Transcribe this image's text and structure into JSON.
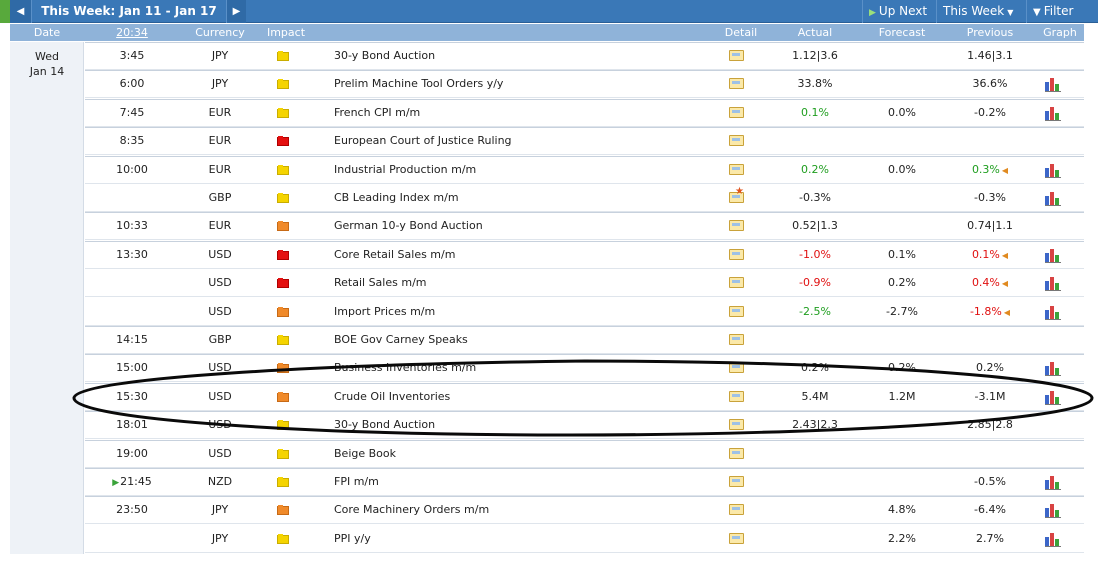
{
  "topbar": {
    "prev_arrow": "◀",
    "title": "This Week: Jan 11 - Jan 17",
    "next_arrow": "▶",
    "up_next": "Up Next",
    "this_week": "This Week",
    "filter": "Filter"
  },
  "header": {
    "date": "Date",
    "time": "20:34",
    "currency": "Currency",
    "impact": "Impact",
    "detail": "Detail",
    "actual": "Actual",
    "forecast": "Forecast",
    "previous": "Previous",
    "graph": "Graph"
  },
  "date_group": {
    "day": "Wed",
    "date": "Jan 14"
  },
  "rows": [
    {
      "time": "3:45",
      "currency": "JPY",
      "impact": "low",
      "event": "30-y Bond Auction",
      "actual": "1.12|3.6",
      "forecast": "",
      "previous": "1.46|3.1",
      "graph": false
    },
    {
      "time": "6:00",
      "currency": "JPY",
      "impact": "low",
      "event": "Prelim Machine Tool Orders y/y",
      "actual": "33.8%",
      "forecast": "",
      "previous": "36.6%",
      "graph": true
    },
    {
      "time": "7:45",
      "currency": "EUR",
      "impact": "low",
      "event": "French CPI m/m",
      "actual": "0.1%",
      "actual_color": "green",
      "forecast": "0.0%",
      "previous": "-0.2%",
      "graph": true
    },
    {
      "time": "8:35",
      "currency": "EUR",
      "impact": "high",
      "event": "European Court of Justice Ruling",
      "actual": "",
      "forecast": "",
      "previous": "",
      "graph": false
    },
    {
      "time": "10:00",
      "currency": "EUR",
      "impact": "low",
      "event": "Industrial Production m/m",
      "actual": "0.2%",
      "actual_color": "green",
      "forecast": "0.0%",
      "previous": "0.3%",
      "previous_color": "green",
      "revised": true,
      "graph": true
    },
    {
      "time": "",
      "currency": "GBP",
      "impact": "low",
      "event": "CB Leading Index m/m",
      "actual": "-0.3%",
      "forecast": "",
      "previous": "-0.3%",
      "graph": true,
      "star": true
    },
    {
      "time": "10:33",
      "currency": "EUR",
      "impact": "medium",
      "event": "German 10-y Bond Auction",
      "actual": "0.52|1.3",
      "forecast": "",
      "previous": "0.74|1.1",
      "graph": false
    },
    {
      "time": "13:30",
      "currency": "USD",
      "impact": "high",
      "event": "Core Retail Sales m/m",
      "actual": "-1.0%",
      "actual_color": "red",
      "forecast": "0.1%",
      "previous": "0.1%",
      "previous_color": "red",
      "revised": true,
      "graph": true
    },
    {
      "time": "",
      "currency": "USD",
      "impact": "high",
      "event": "Retail Sales m/m",
      "actual": "-0.9%",
      "actual_color": "red",
      "forecast": "0.2%",
      "previous": "0.4%",
      "previous_color": "red",
      "revised": true,
      "graph": true
    },
    {
      "time": "",
      "currency": "USD",
      "impact": "medium",
      "event": "Import Prices m/m",
      "actual": "-2.5%",
      "actual_color": "green",
      "forecast": "-2.7%",
      "previous": "-1.8%",
      "previous_color": "red",
      "revised": true,
      "graph": true
    },
    {
      "time": "14:15",
      "currency": "GBP",
      "impact": "low",
      "event": "BOE Gov Carney Speaks",
      "actual": "",
      "forecast": "",
      "previous": "",
      "graph": false
    },
    {
      "time": "15:00",
      "currency": "USD",
      "impact": "medium",
      "event": "Business Inventories m/m",
      "actual": "0.2%",
      "forecast": "0.2%",
      "previous": "0.2%",
      "graph": true
    },
    {
      "time": "15:30",
      "currency": "USD",
      "impact": "medium",
      "event": "Crude Oil Inventories",
      "actual": "5.4M",
      "forecast": "1.2M",
      "previous": "-3.1M",
      "graph": true
    },
    {
      "time": "18:01",
      "currency": "USD",
      "impact": "low",
      "event": "30-y Bond Auction",
      "actual": "2.43|2.3",
      "forecast": "",
      "previous": "2.85|2.8",
      "graph": false
    },
    {
      "time": "19:00",
      "currency": "USD",
      "impact": "low",
      "event": "Beige Book",
      "actual": "",
      "forecast": "",
      "previous": "",
      "graph": false
    },
    {
      "time": "21:45",
      "currency": "NZD",
      "impact": "low",
      "event": "FPI m/m",
      "actual": "",
      "forecast": "",
      "previous": "-0.5%",
      "graph": true,
      "upcoming": true
    },
    {
      "time": "23:50",
      "currency": "JPY",
      "impact": "medium",
      "event": "Core Machinery Orders m/m",
      "actual": "",
      "forecast": "4.8%",
      "previous": "-6.4%",
      "graph": true
    },
    {
      "time": "",
      "currency": "JPY",
      "impact": "low",
      "event": "PPI y/y",
      "actual": "",
      "forecast": "2.2%",
      "previous": "2.7%",
      "graph": true
    }
  ],
  "colors": {
    "green": "#1f9e1f",
    "red": "#e01010",
    "header": "#8fb3d9",
    "topbar": "#3a78b7"
  }
}
